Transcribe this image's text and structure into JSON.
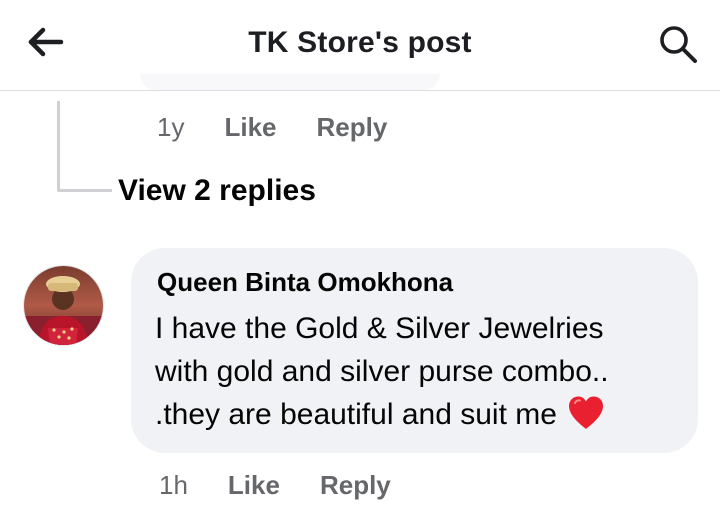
{
  "header": {
    "title": "TK Store's post",
    "back_icon": "arrow-left-icon",
    "search_icon": "search-icon"
  },
  "previous_comment": {
    "time": "1y",
    "like_label": "Like",
    "reply_label": "Reply",
    "view_replies_label": "View 2 replies"
  },
  "comment": {
    "author": "Queen Binta Omokhona",
    "text_lines": [
      "I have the Gold & Silver Jewelries",
      "with gold and silver purse combo..",
      ".they are beautiful and suit me"
    ],
    "emoji": "heart-emoji",
    "time": "1h",
    "like_label": "Like",
    "reply_label": "Reply"
  },
  "colors": {
    "bubble": "#f0f2f5",
    "secondary_text": "#65676b",
    "heart": "#e8202f"
  }
}
